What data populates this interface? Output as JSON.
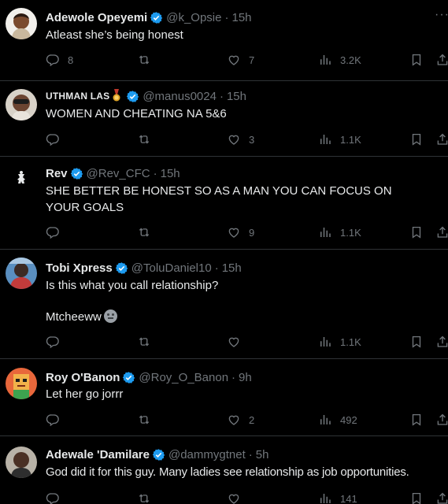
{
  "tweets": [
    {
      "name": "Adewole Opeyemi",
      "handle": "@k_Opsie",
      "time": "15h",
      "text": "Atleast she’s being honest",
      "text2": "",
      "replies": "8",
      "retweets": "",
      "likes": "7",
      "views": "3.2K"
    },
    {
      "name": "UTHMAN LAS",
      "handle": "@manus0024",
      "time": "15h",
      "text": "WOMEN AND CHEATING NA 5&6",
      "text2": "",
      "replies": "",
      "retweets": "",
      "likes": "3",
      "views": "1.1K"
    },
    {
      "name": "Rev",
      "handle": "@Rev_CFC",
      "time": "15h",
      "text": "SHE BETTER BE HONEST SO AS A MAN YOU CAN FOCUS ON YOUR GOALS",
      "text2": "",
      "replies": "",
      "retweets": "",
      "likes": "9",
      "views": "1.1K"
    },
    {
      "name": "Tobi Xpress",
      "handle": "@ToluDaniel10",
      "time": "15h",
      "text": "Is this what you call relationship?",
      "text2": "Mtcheeww",
      "replies": "",
      "retweets": "",
      "likes": "",
      "views": "1.1K"
    },
    {
      "name": "Roy O'Banon",
      "handle": "@Roy_O_Banon",
      "time": "9h",
      "text": "Let her go jorrr",
      "text2": "",
      "replies": "",
      "retweets": "",
      "likes": "2",
      "views": "492"
    },
    {
      "name": "Adewale 'Damilare",
      "handle": "@dammygtnet",
      "time": "5h",
      "text": "God did it for this guy. Many ladies see relationship as job opportunities.",
      "text2": "",
      "replies": "",
      "retweets": "",
      "likes": "",
      "views": "141"
    }
  ],
  "icons": {
    "reply": "reply-icon",
    "retweet": "retweet-icon",
    "like": "heart-icon",
    "views": "views-icon",
    "bookmark": "bookmark-icon",
    "share": "share-icon",
    "verified": "verified-badge-icon",
    "more": "more-icon"
  },
  "colors": {
    "background": "#000000",
    "text": "#e7e9ea",
    "muted": "#71767b",
    "verified": "#1d9bf0",
    "divider": "#2f3336"
  },
  "separator": "·",
  "more_glyph": "···"
}
